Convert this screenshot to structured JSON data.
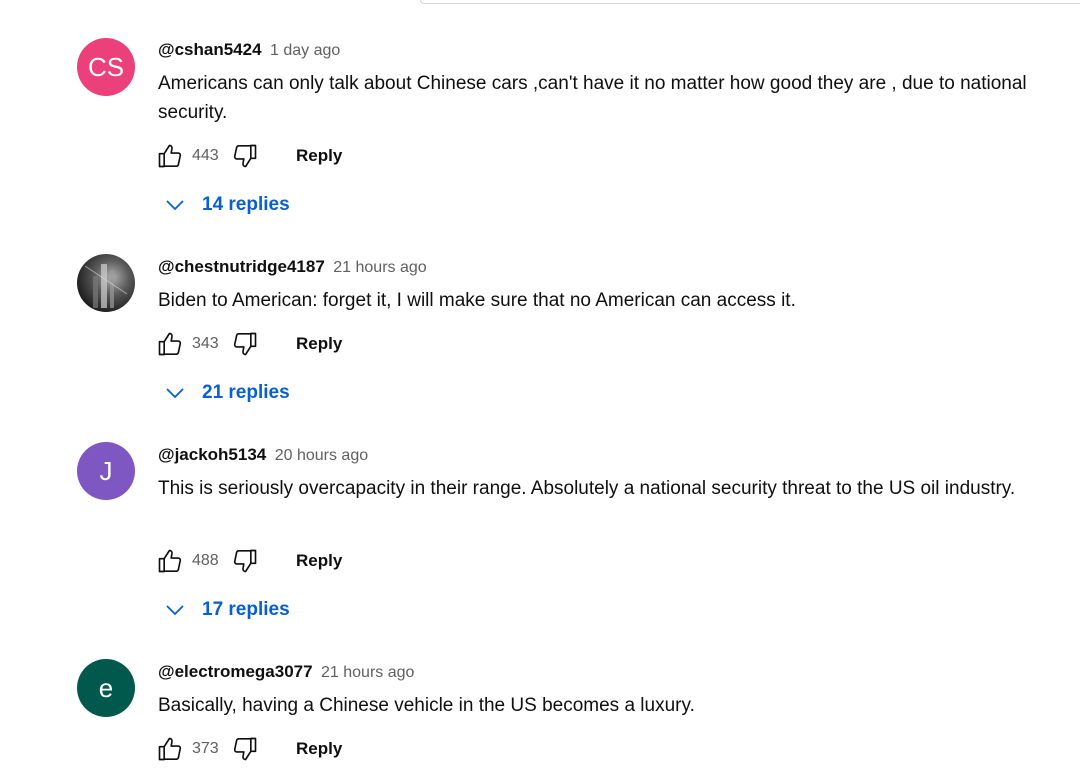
{
  "comments": [
    {
      "author": "@cshan5424",
      "time": "1 day ago",
      "avatar_text": "CS",
      "avatar_color": "#ec407a",
      "text": "Americans can only talk about Chinese cars ,can't  have it no matter how good they are , due to national security.",
      "likes": "443",
      "reply_label": "Reply",
      "replies_label": "14 replies"
    },
    {
      "author": "@chestnutridge4187",
      "time": "21 hours ago",
      "avatar_text": "",
      "avatar_color": "#3a3a3a",
      "text": "Biden to American: forget it, I will make sure that no American can access it.",
      "likes": "343",
      "reply_label": "Reply",
      "replies_label": "21 replies"
    },
    {
      "author": "@jackoh5134",
      "time": "20 hours ago",
      "avatar_text": "J",
      "avatar_color": "#7e57c2",
      "text": "This is seriously overcapacity in their range. Absolutely a national security threat to the US oil industry.",
      "likes": "488",
      "reply_label": "Reply",
      "replies_label": "17 replies"
    },
    {
      "author": "@electromega3077",
      "time": "21 hours ago",
      "avatar_text": "e",
      "avatar_color": "#00594c",
      "text": "Basically, having a Chinese vehicle in the US becomes a luxury.",
      "likes": "373",
      "reply_label": "Reply"
    }
  ],
  "colors": {
    "link_blue": "#065fd4",
    "meta_gray": "#606060",
    "text": "#0f0f0f"
  },
  "icons": {
    "like": "thumbs-up-outline",
    "dislike": "thumbs-down-outline",
    "expand": "chevron-down"
  }
}
